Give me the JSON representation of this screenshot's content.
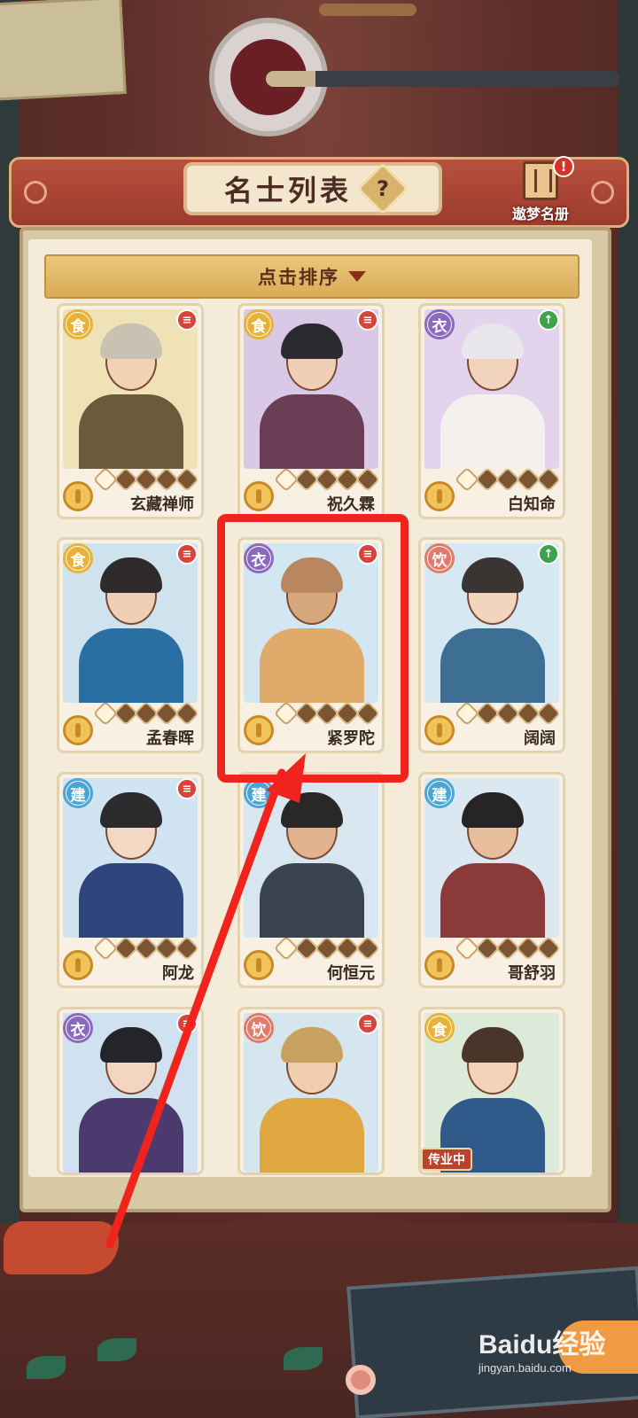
{
  "header": {
    "title": "名士列表",
    "help_label": "?",
    "book_label": "遨梦名册",
    "book_alert": "!"
  },
  "sort": {
    "label": "点击排序"
  },
  "cards": [
    {
      "name": "玄藏禅师",
      "category": "食",
      "corner": "scroll",
      "stars_filled": 1,
      "bg": "#efe2b6",
      "skin": "#f2d1b5",
      "hair": "#c9c1b2",
      "body": "#6b5b3a"
    },
    {
      "name": "祝久霖",
      "category": "食",
      "corner": "scroll",
      "stars_filled": 1,
      "bg": "#d9c9e6",
      "skin": "#efcfb6",
      "hair": "#2b2a30",
      "body": "#6a3f55"
    },
    {
      "name": "白知命",
      "category": "衣",
      "corner": "up",
      "stars_filled": 1,
      "bg": "#e3d3ec",
      "skin": "#f2d3bd",
      "hair": "#e8e6ea",
      "body": "#f3f0ee"
    },
    {
      "name": "孟春晖",
      "category": "食",
      "corner": "scroll",
      "stars_filled": 1,
      "bg": "#cfe3ef",
      "skin": "#f0cfb4",
      "hair": "#2e2a2a",
      "body": "#2a6fa3"
    },
    {
      "name": "紧罗陀",
      "category": "衣",
      "corner": "scroll",
      "stars_filled": 1,
      "bg": "#d2e7f2",
      "skin": "#d7a77c",
      "hair": "#b8875f",
      "body": "#e0ab6a"
    },
    {
      "name": "阔阔",
      "category": "饮",
      "corner": "up",
      "stars_filled": 1,
      "bg": "#d6e9f3",
      "skin": "#f2d5bf",
      "hair": "#3a3533",
      "body": "#3d6f94"
    },
    {
      "name": "阿龙",
      "category": "建",
      "corner": "scroll",
      "stars_filled": 1,
      "bg": "#d1e4f1",
      "skin": "#f3d8c4",
      "hair": "#2d2a2e",
      "body": "#31457d"
    },
    {
      "name": "何恒元",
      "category": "建",
      "corner": "",
      "stars_filled": 1,
      "bg": "#d8e6ef",
      "skin": "#e3b38f",
      "hair": "#2a2827",
      "body": "#3b4350"
    },
    {
      "name": "哥舒羽",
      "category": "建",
      "corner": "",
      "stars_filled": 1,
      "bg": "#dce8f1",
      "skin": "#e6be9c",
      "hair": "#262424",
      "body": "#8b3a3a"
    },
    {
      "name": "",
      "category": "衣",
      "corner": "scroll",
      "stars_filled": 1,
      "bg": "#d0e2ef",
      "skin": "#f3d6c1",
      "hair": "#23252a",
      "body": "#4a3a6e"
    },
    {
      "name": "",
      "category": "饮",
      "corner": "scroll",
      "stars_filled": 1,
      "bg": "#d6e6ef",
      "skin": "#f1cfae",
      "hair": "#c8a060",
      "body": "#e0a640"
    },
    {
      "name": "",
      "category": "食",
      "corner": "",
      "stars_filled": 1,
      "bg": "#dcebd9",
      "skin": "#f3d4ba",
      "hair": "#4a352b",
      "body": "#2f5a8a",
      "status": "传业中"
    }
  ],
  "category_colors": {
    "食": "#e6b23a",
    "衣": "#8a6ac0",
    "饮": "#e07a6a",
    "建": "#4aa5d6"
  },
  "watermark": {
    "logo": "Baidu经验",
    "url": "jingyan.baidu.com"
  },
  "annotation": {
    "highlight_color": "#f0241d",
    "highlighted_card": "紧罗陀"
  }
}
